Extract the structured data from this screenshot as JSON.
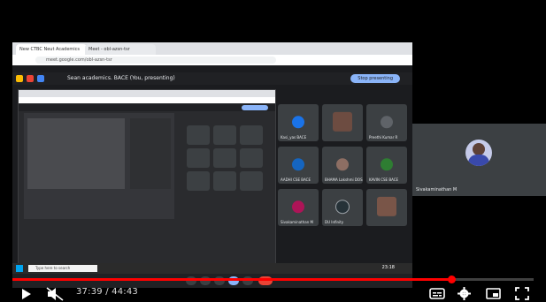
{
  "browser": {
    "tabs": [
      "New CTBC Neut Academics",
      "Meet - obl-azsn-tsr"
    ],
    "address": "meet.google.com/obl-azsn-tsr"
  },
  "meet": {
    "title": "Sean academics. BACE (You, presenting)",
    "stop_label": "Stop presenting",
    "participants": [
      {
        "name": "Kasi_yas BACE",
        "color": "#1a73e8"
      },
      {
        "name": "",
        "color": "#6d4c41"
      },
      {
        "name": "Preethi Kumar R",
        "color": "#5f6368"
      },
      {
        "name": "AADHI CSE BACE",
        "color": "#1565c0"
      },
      {
        "name": "BHAMA Lakshmi DOS",
        "color": "#8d6e63"
      },
      {
        "name": "KAVIN CSE BACE",
        "color": "#2e7d32"
      },
      {
        "name": "Sivakaminathan M",
        "color": "#ad1457"
      },
      {
        "name": "DU Infinity",
        "color": "#263238"
      },
      {
        "name": "",
        "color": "#795548"
      }
    ],
    "taskbar_search": "Type here to search",
    "clock": "23:18"
  },
  "presenter": {
    "name": "Sivakaminathan M"
  },
  "player": {
    "current": "37:39",
    "duration": "44:43",
    "progress": 0.842,
    "time_label": "37:39 / 44:43"
  }
}
